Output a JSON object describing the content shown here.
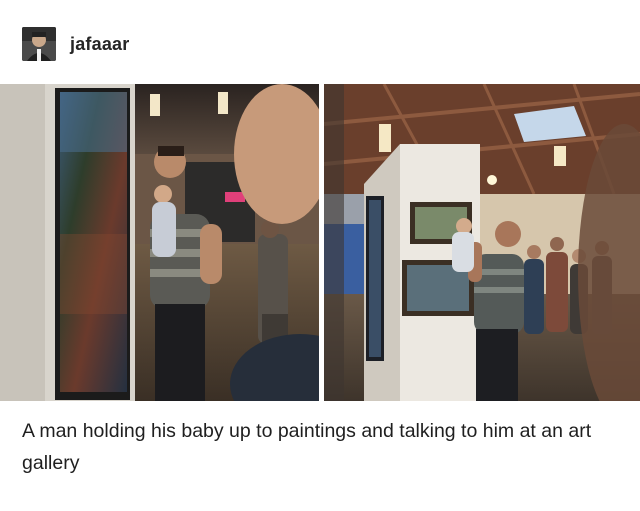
{
  "post": {
    "username": "jafaaar",
    "avatar_icon": "user-avatar-icon",
    "caption": "A man holding his baby up to paintings and talking to him at an art gallery"
  },
  "photos": [
    {
      "name": "gallery-photo-left"
    },
    {
      "name": "gallery-photo-right"
    }
  ]
}
